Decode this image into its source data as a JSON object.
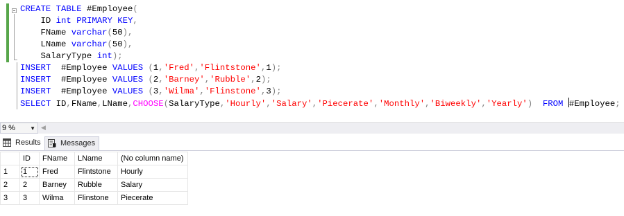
{
  "editor": {
    "lines": [
      [
        {
          "t": "CREATE",
          "c": "kw"
        },
        {
          "t": " ",
          "c": ""
        },
        {
          "t": "TABLE",
          "c": "kw"
        },
        {
          "t": " #Employee",
          "c": ""
        },
        {
          "t": "(",
          "c": "gr"
        }
      ],
      [
        {
          "t": "    ID ",
          "c": ""
        },
        {
          "t": "int",
          "c": "kw"
        },
        {
          "t": " ",
          "c": ""
        },
        {
          "t": "PRIMARY",
          "c": "kw"
        },
        {
          "t": " ",
          "c": ""
        },
        {
          "t": "KEY",
          "c": "kw"
        },
        {
          "t": ",",
          "c": "gr"
        }
      ],
      [
        {
          "t": "    FName ",
          "c": ""
        },
        {
          "t": "varchar",
          "c": "kw"
        },
        {
          "t": "(",
          "c": "gr"
        },
        {
          "t": "50",
          "c": ""
        },
        {
          "t": "),",
          "c": "gr"
        }
      ],
      [
        {
          "t": "    LName ",
          "c": ""
        },
        {
          "t": "varchar",
          "c": "kw"
        },
        {
          "t": "(",
          "c": "gr"
        },
        {
          "t": "50",
          "c": ""
        },
        {
          "t": "),",
          "c": "gr"
        }
      ],
      [
        {
          "t": "    SalaryType ",
          "c": ""
        },
        {
          "t": "int",
          "c": "kw"
        },
        {
          "t": ");",
          "c": "gr"
        }
      ],
      [
        {
          "t": "INSERT",
          "c": "kw"
        },
        {
          "t": "  #Employee ",
          "c": ""
        },
        {
          "t": "VALUES",
          "c": "kw"
        },
        {
          "t": " ",
          "c": ""
        },
        {
          "t": "(",
          "c": "gr"
        },
        {
          "t": "1",
          "c": ""
        },
        {
          "t": ",",
          "c": "gr"
        },
        {
          "t": "'Fred'",
          "c": "str"
        },
        {
          "t": ",",
          "c": "gr"
        },
        {
          "t": "'Flintstone'",
          "c": "str"
        },
        {
          "t": ",",
          "c": "gr"
        },
        {
          "t": "1",
          "c": ""
        },
        {
          "t": ");",
          "c": "gr"
        }
      ],
      [
        {
          "t": "INSERT",
          "c": "kw"
        },
        {
          "t": "  #Employee ",
          "c": ""
        },
        {
          "t": "VALUES",
          "c": "kw"
        },
        {
          "t": " ",
          "c": ""
        },
        {
          "t": "(",
          "c": "gr"
        },
        {
          "t": "2",
          "c": ""
        },
        {
          "t": ",",
          "c": "gr"
        },
        {
          "t": "'Barney'",
          "c": "str"
        },
        {
          "t": ",",
          "c": "gr"
        },
        {
          "t": "'Rubble'",
          "c": "str"
        },
        {
          "t": ",",
          "c": "gr"
        },
        {
          "t": "2",
          "c": ""
        },
        {
          "t": ");",
          "c": "gr"
        }
      ],
      [
        {
          "t": "INSERT",
          "c": "kw"
        },
        {
          "t": "  #Employee ",
          "c": ""
        },
        {
          "t": "VALUES",
          "c": "kw"
        },
        {
          "t": " ",
          "c": ""
        },
        {
          "t": "(",
          "c": "gr"
        },
        {
          "t": "3",
          "c": ""
        },
        {
          "t": ",",
          "c": "gr"
        },
        {
          "t": "'Wilma'",
          "c": "str"
        },
        {
          "t": ",",
          "c": "gr"
        },
        {
          "t": "'Flinstone'",
          "c": "str"
        },
        {
          "t": ",",
          "c": "gr"
        },
        {
          "t": "3",
          "c": ""
        },
        {
          "t": ");",
          "c": "gr"
        }
      ],
      [
        {
          "t": "SELECT",
          "c": "kw"
        },
        {
          "t": " ID",
          "c": ""
        },
        {
          "t": ",",
          "c": "gr"
        },
        {
          "t": "FName",
          "c": ""
        },
        {
          "t": ",",
          "c": "gr"
        },
        {
          "t": "LName",
          "c": ""
        },
        {
          "t": ",",
          "c": "gr"
        },
        {
          "t": "CHOOSE",
          "c": "fn"
        },
        {
          "t": "(",
          "c": "gr"
        },
        {
          "t": "SalaryType",
          "c": ""
        },
        {
          "t": ",",
          "c": "gr"
        },
        {
          "t": "'Hourly'",
          "c": "str"
        },
        {
          "t": ",",
          "c": "gr"
        },
        {
          "t": "'Salary'",
          "c": "str"
        },
        {
          "t": ",",
          "c": "gr"
        },
        {
          "t": "'Piecerate'",
          "c": "str"
        },
        {
          "t": ",",
          "c": "gr"
        },
        {
          "t": "'Monthly'",
          "c": "str"
        },
        {
          "t": ",",
          "c": "gr"
        },
        {
          "t": "'Biweekly'",
          "c": "str"
        },
        {
          "t": ",",
          "c": "gr"
        },
        {
          "t": "'Yearly'",
          "c": "str"
        },
        {
          "t": ")",
          "c": "gr"
        },
        {
          "t": "  ",
          "c": ""
        },
        {
          "t": "FROM",
          "c": "kw"
        },
        {
          "t": " ",
          "c": ""
        },
        {
          "t": "|",
          "c": "caret"
        },
        {
          "t": "#Employee",
          "c": ""
        },
        {
          "t": ";",
          "c": "gr"
        }
      ]
    ],
    "colors": {
      "keyword": "#0000ff",
      "string": "#ff0000",
      "function": "#ff00ff",
      "punctuation": "#808080",
      "change_bar": "#57a64a"
    }
  },
  "zoom": {
    "value": "9 %"
  },
  "tabs": {
    "results": "Results",
    "messages": "Messages"
  },
  "grid": {
    "columns": [
      "ID",
      "FName",
      "LName",
      "(No column name)"
    ],
    "rows": [
      {
        "num": "1",
        "cells": [
          "1",
          "Fred",
          "Flintstone",
          "Hourly"
        ]
      },
      {
        "num": "2",
        "cells": [
          "2",
          "Barney",
          "Rubble",
          "Salary"
        ]
      },
      {
        "num": "3",
        "cells": [
          "3",
          "Wilma",
          "Flinstone",
          "Piecerate"
        ]
      }
    ]
  }
}
